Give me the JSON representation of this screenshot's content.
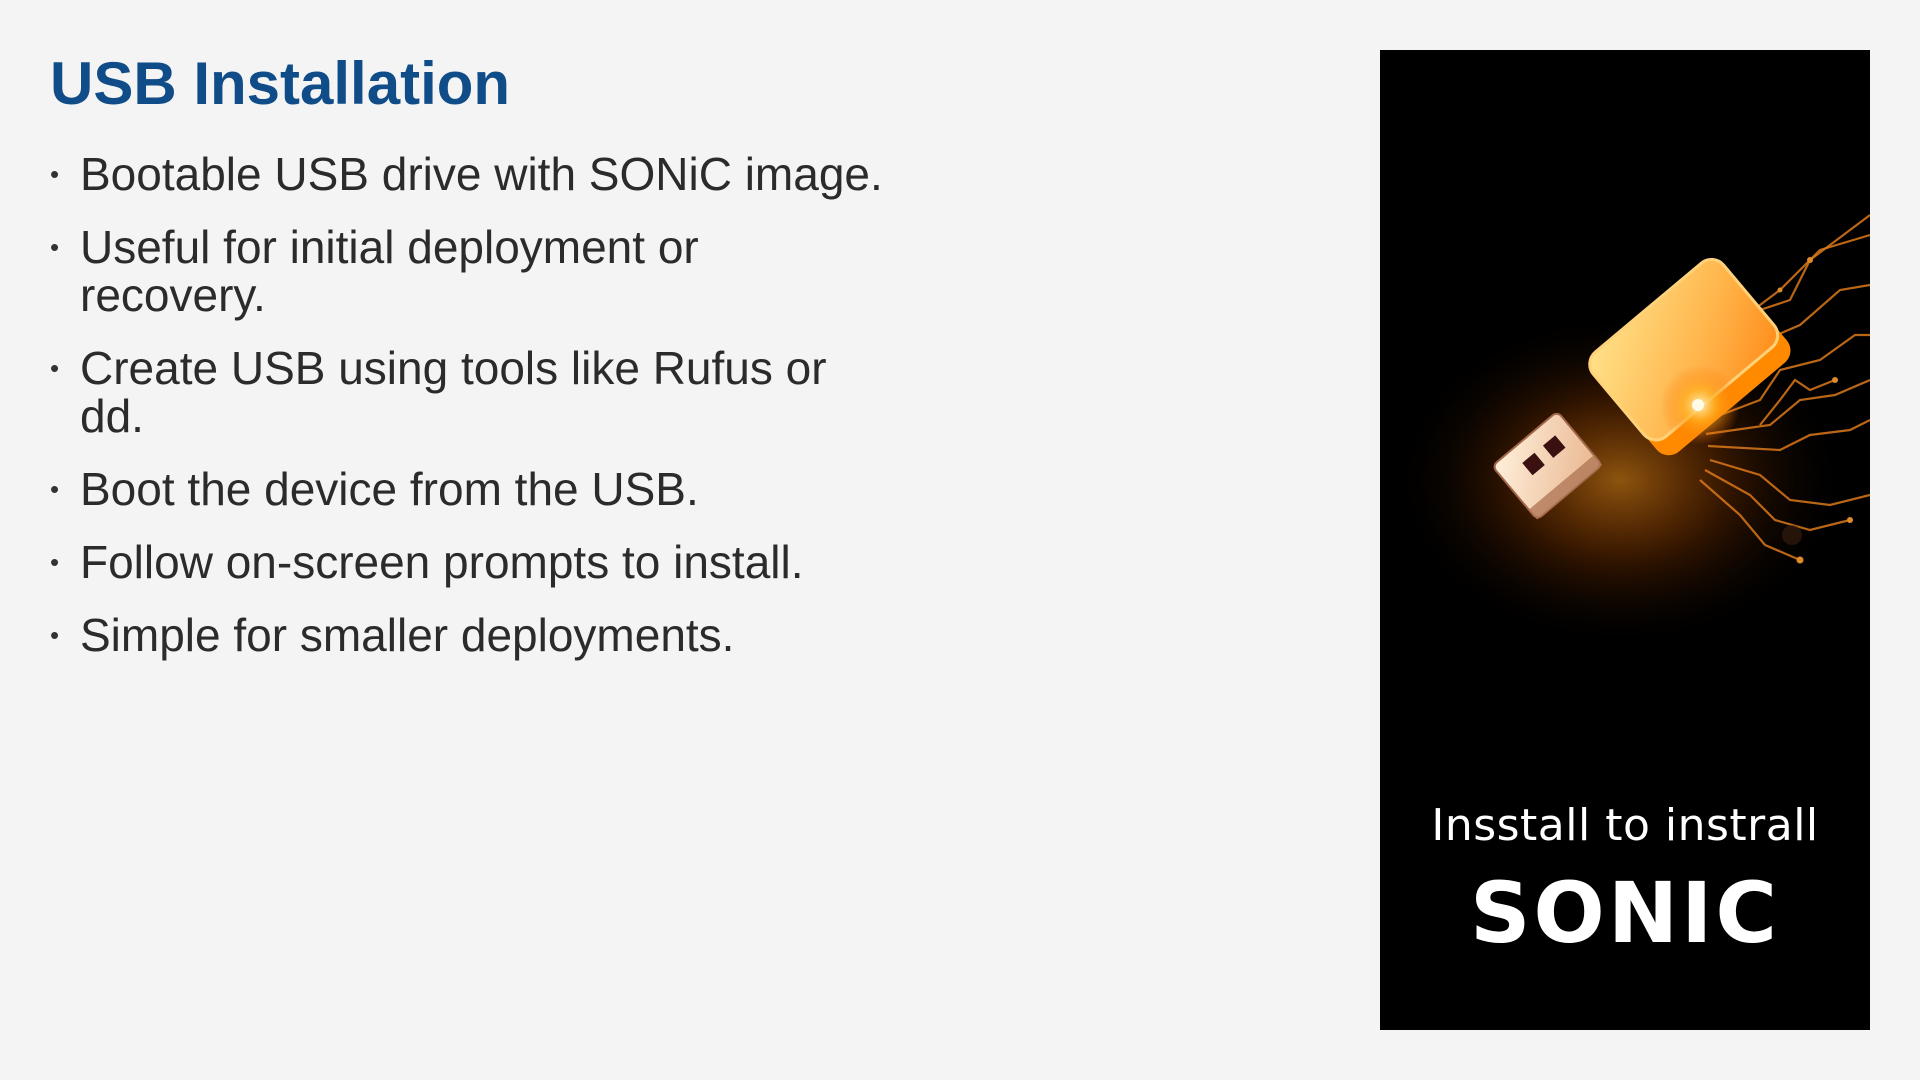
{
  "slide": {
    "title": "USB Installation",
    "bullets": [
      {
        "text": "Bootable USB drive with SONiC image."
      },
      {
        "text": "Useful for initial deployment or recovery."
      },
      {
        "text": "Create USB using tools like Rufus or dd."
      },
      {
        "text": "Boot the device from the USB."
      },
      {
        "text": "Follow on-screen prompts to install."
      },
      {
        "text": "Simple for smaller deployments."
      }
    ],
    "bullet_glyph": "•"
  },
  "image": {
    "description_icon": "usb-drive-icon",
    "caption_line1": "Insstall to instrall",
    "caption_line2": "SONIC"
  },
  "colors": {
    "title": "#0f4c88",
    "text": "#2b2b2b",
    "background": "#f4f4f4",
    "image_background": "#000000",
    "glow": "#ff8a00"
  }
}
